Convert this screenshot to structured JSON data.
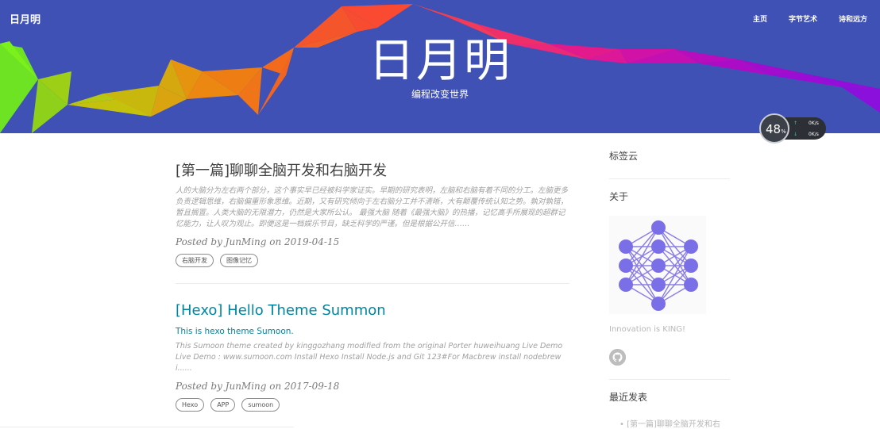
{
  "header": {
    "brand": "日月明",
    "nav": [
      "主页",
      "字节艺术",
      "诗和远方"
    ],
    "title": "日月明",
    "subtitle": "编程改变世界"
  },
  "speed_widget": {
    "percent": "48",
    "percent_unit": "%",
    "upload": "0K/s",
    "download": "0K/s"
  },
  "posts": [
    {
      "title": "[第一篇]聊聊全脑开发和右脑开发",
      "excerpt": "人的大脑分为左右两个部分，这个事实早已经被科学家证实。早期的研究表明，左脑和右脑有着不同的分工。左脑更多负责逻辑思维，右脑偏重形象思维。近期，又有研究倾向于左右脑分工并不清晰，大有颠覆传统认知之势。孰对孰错，暂且搁置。人类大脑的无限潜力，仍然是大家所公认。 最强大脑 随着《最强大脑》的热播，记忆高手所展现的超群记忆能力，让人叹为观止。即便这是一档娱乐节目，缺乏科学的严谨。但是根据公开信……",
      "meta": "Posted by JunMing on 2019-04-15",
      "tags": [
        "右脑开发",
        "图像记忆"
      ]
    },
    {
      "title": "[Hexo] Hello Theme Summon",
      "subtitle": "This is hexo theme Sumoon.",
      "excerpt": "This Sumoon theme created by kinggozhang modified from the original Porter huweihuang Live Demo Live Demo : www.sumoon.com Install Hexo Install Node.js and Git 123#For Macbrew install nodebrew i......",
      "meta": "Posted by JunMing on 2017-09-18",
      "tags": [
        "Hexo",
        "APP",
        "sumoon"
      ]
    }
  ],
  "sidebar": {
    "tag_cloud": "标签云",
    "about": "关于",
    "motto": "Innovation is KING!",
    "recent_heading": "最近发表",
    "recent": [
      "[第一篇]聊聊全脑开发和右"
    ]
  },
  "colors": {
    "header_bg": "#3f51b5",
    "link": "#0085a1"
  }
}
